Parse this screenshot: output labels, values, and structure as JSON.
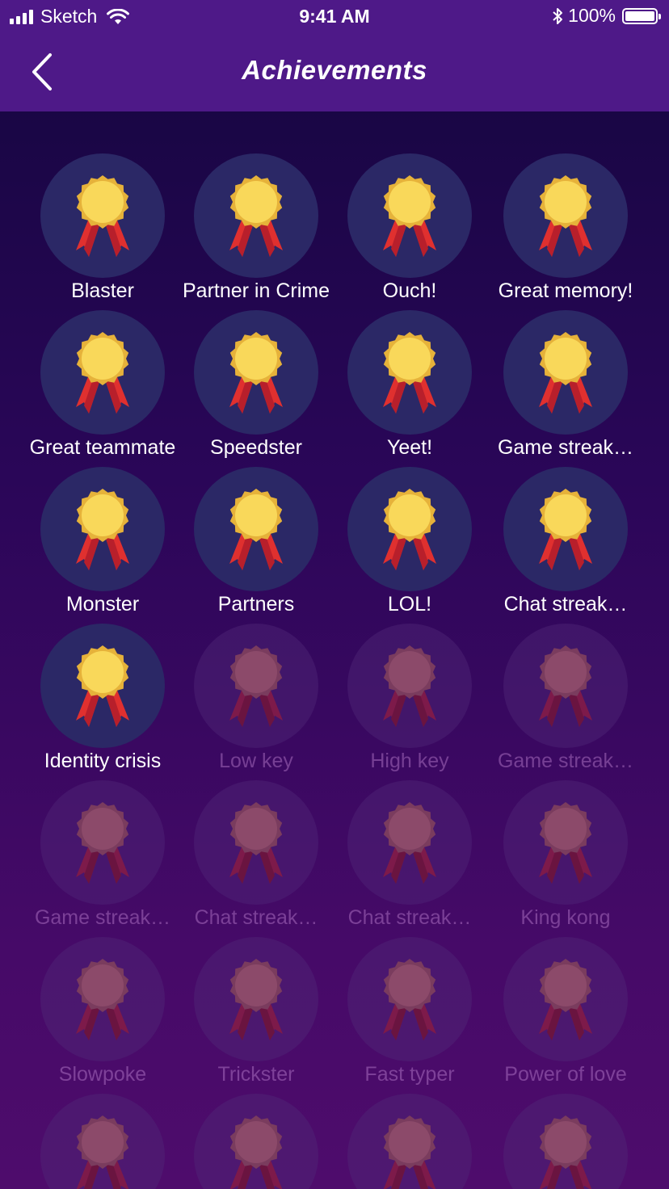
{
  "status_bar": {
    "carrier": "Sketch",
    "time": "9:41 AM",
    "battery": "100%"
  },
  "header": {
    "title": "Achievements"
  },
  "colors": {
    "header_bg": "#4e1988",
    "badge_bg": "#2b2866",
    "medal_gold": "#f9d85a",
    "ribbon_red": "#e0302f"
  },
  "achievements": [
    {
      "label": "Blaster",
      "unlocked": true
    },
    {
      "label": "Partner in Crime",
      "unlocked": true
    },
    {
      "label": "Ouch!",
      "unlocked": true
    },
    {
      "label": "Great memory!",
      "unlocked": true
    },
    {
      "label": "Great teammate",
      "unlocked": true
    },
    {
      "label": "Speedster",
      "unlocked": true
    },
    {
      "label": "Yeet!",
      "unlocked": true
    },
    {
      "label": "Game streak…",
      "unlocked": true
    },
    {
      "label": "Monster",
      "unlocked": true
    },
    {
      "label": "Partners",
      "unlocked": true
    },
    {
      "label": "LOL!",
      "unlocked": true
    },
    {
      "label": "Chat streak…",
      "unlocked": true
    },
    {
      "label": "Identity crisis",
      "unlocked": true
    },
    {
      "label": "Low key",
      "unlocked": false
    },
    {
      "label": "High key",
      "unlocked": false
    },
    {
      "label": "Game streak…",
      "unlocked": false
    },
    {
      "label": "Game streak…",
      "unlocked": false
    },
    {
      "label": "Chat streak…",
      "unlocked": false
    },
    {
      "label": "Chat streak…",
      "unlocked": false
    },
    {
      "label": "King kong",
      "unlocked": false
    },
    {
      "label": "Slowpoke",
      "unlocked": false
    },
    {
      "label": "Trickster",
      "unlocked": false
    },
    {
      "label": "Fast typer",
      "unlocked": false
    },
    {
      "label": "Power of love",
      "unlocked": false
    },
    {
      "label": "",
      "unlocked": false
    },
    {
      "label": "",
      "unlocked": false
    },
    {
      "label": "",
      "unlocked": false
    },
    {
      "label": "",
      "unlocked": false
    }
  ]
}
